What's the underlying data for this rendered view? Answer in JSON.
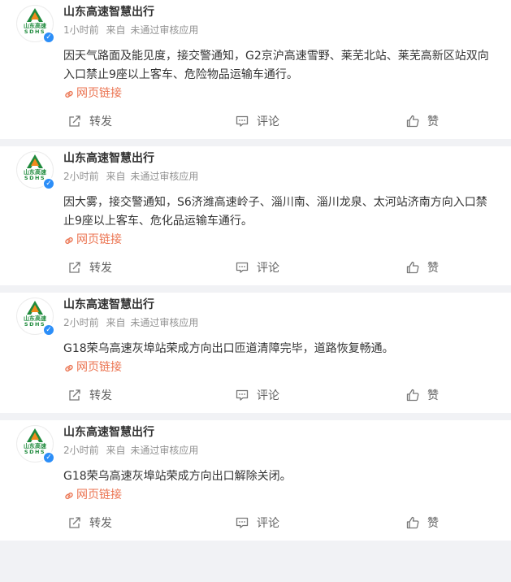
{
  "colors": {
    "link": "#eb7350",
    "verified": "#2c8ef8",
    "logo_green": "#1e8a3c",
    "logo_orange": "#f08a1c"
  },
  "account": {
    "name": "山东高速智慧出行",
    "logo_text_top": "山东高速",
    "logo_text_bottom": "SDHS"
  },
  "actions": {
    "forward": "转发",
    "comment": "评论",
    "like": "赞"
  },
  "posts": [
    {
      "time": "1小时前",
      "source_prefix": "来自",
      "source": "未通过审核应用",
      "content": "因天气路面及能见度，接交警通知，G2京沪高速雪野、莱芜北站、莱芜高新区站双向入口禁止9座以上客车、危险物品运输车通行。",
      "link": "网页链接"
    },
    {
      "time": "2小时前",
      "source_prefix": "来自",
      "source": "未通过审核应用",
      "content": "因大雾，接交警通知，S6济潍高速岭子、淄川南、淄川龙泉、太河站济南方向入口禁止9座以上客车、危化品运输车通行。",
      "link": "网页链接"
    },
    {
      "time": "2小时前",
      "source_prefix": "来自",
      "source": "未通过审核应用",
      "content": "G18荣乌高速灰埠站荣成方向出口匝道清障完毕，道路恢复畅通。",
      "link": "网页链接"
    },
    {
      "time": "2小时前",
      "source_prefix": "来自",
      "source": "未通过审核应用",
      "content": "G18荣乌高速灰埠站荣成方向出口解除关闭。",
      "link": "网页链接"
    }
  ]
}
